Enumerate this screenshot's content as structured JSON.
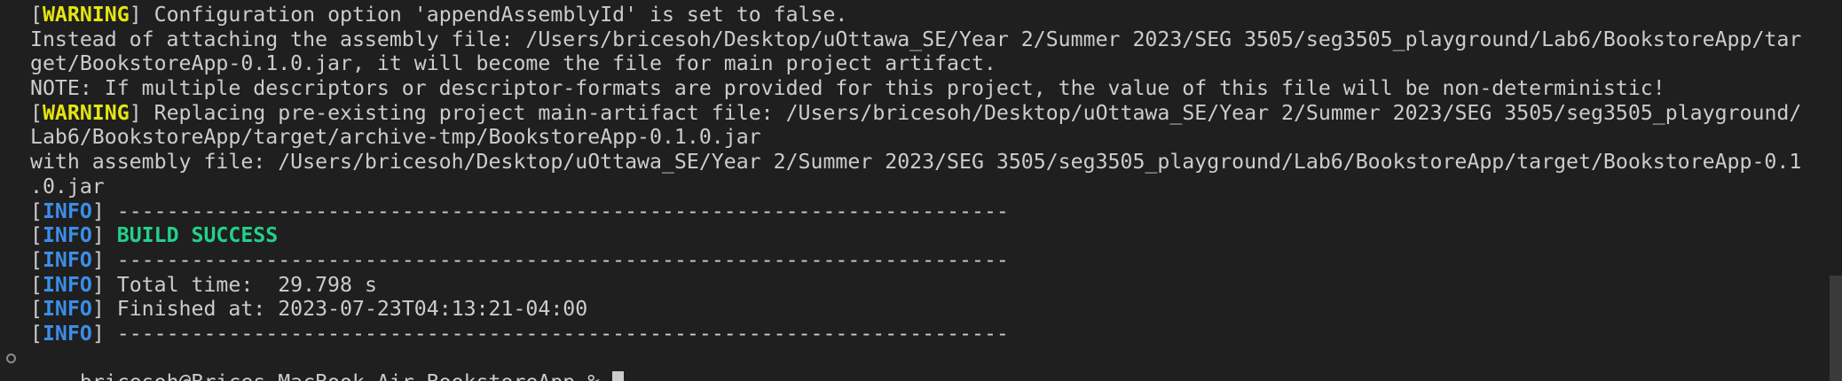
{
  "terminal": {
    "lines": [
      {
        "kind": "warn",
        "tag": "WARNING",
        "text": " Configuration option 'appendAssemblyId' is set to false."
      },
      {
        "kind": "plain",
        "text": "Instead of attaching the assembly file: /Users/bricesoh/Desktop/uOttawa_SE/Year 2/Summer 2023/SEG 3505/seg3505_playground/Lab6/BookstoreApp/tar"
      },
      {
        "kind": "plain",
        "text": "get/BookstoreApp-0.1.0.jar, it will become the file for main project artifact."
      },
      {
        "kind": "plain",
        "text": "NOTE: If multiple descriptors or descriptor-formats are provided for this project, the value of this file will be non-deterministic!"
      },
      {
        "kind": "warn",
        "tag": "WARNING",
        "text": " Replacing pre-existing project main-artifact file: /Users/bricesoh/Desktop/uOttawa_SE/Year 2/Summer 2023/SEG 3505/seg3505_playground/"
      },
      {
        "kind": "plain",
        "text": "Lab6/BookstoreApp/target/archive-tmp/BookstoreApp-0.1.0.jar"
      },
      {
        "kind": "plain",
        "text": "with assembly file: /Users/bricesoh/Desktop/uOttawa_SE/Year 2/Summer 2023/SEG 3505/seg3505_playground/Lab6/BookstoreApp/target/BookstoreApp-0.1"
      },
      {
        "kind": "plain",
        "text": ".0.jar"
      },
      {
        "kind": "info",
        "tag": "INFO",
        "text": " ------------------------------------------------------------------------"
      },
      {
        "kind": "success",
        "tag": "INFO",
        "text": "BUILD SUCCESS"
      },
      {
        "kind": "info",
        "tag": "INFO",
        "text": " ------------------------------------------------------------------------"
      },
      {
        "kind": "info",
        "tag": "INFO",
        "text": " Total time:  29.798 s"
      },
      {
        "kind": "info",
        "tag": "INFO",
        "text": " Finished at: 2023-07-23T04:13:21-04:00"
      },
      {
        "kind": "info",
        "tag": "INFO",
        "text": " ------------------------------------------------------------------------"
      }
    ],
    "prompt": "bricesoh@Brices-MacBook-Air BookstoreApp % "
  },
  "colors": {
    "background": "#1f1f1f",
    "text": "#cccccc",
    "warning": "#e5e510",
    "info": "#3b8eea",
    "success": "#23d18b"
  }
}
